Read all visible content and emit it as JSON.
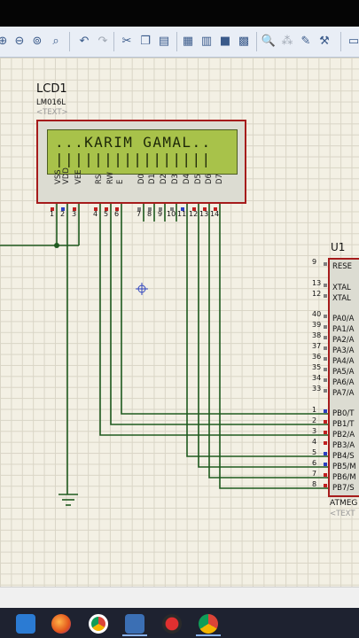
{
  "component_lcd": {
    "ref": "LCD1",
    "model": "LM016L",
    "text_placeholder": "<TEXT>",
    "line1": "...KARIM GAMAL..",
    "line2": "||||||||||||||||",
    "pin_names": [
      "VSS",
      "VDD",
      "VEE",
      "RS",
      "RW",
      "E",
      "D0",
      "D1",
      "D2",
      "D3",
      "D4",
      "D5",
      "D6",
      "D7"
    ],
    "pin_numbers": [
      "1",
      "2",
      "3",
      "4",
      "5",
      "6",
      "7",
      "8",
      "9",
      "10",
      "11",
      "12",
      "13",
      "14"
    ]
  },
  "component_mcu": {
    "ref": "U1",
    "part_label": "ATMEG",
    "text_placeholder": "<TEXT",
    "pins": [
      {
        "num": "9",
        "name": "RESE"
      },
      {
        "num": "13",
        "name": "XTAL"
      },
      {
        "num": "12",
        "name": "XTAL"
      },
      {
        "num": "40",
        "name": "PA0/A"
      },
      {
        "num": "39",
        "name": "PA1/A"
      },
      {
        "num": "38",
        "name": "PA2/A"
      },
      {
        "num": "37",
        "name": "PA3/A"
      },
      {
        "num": "36",
        "name": "PA4/A"
      },
      {
        "num": "35",
        "name": "PA5/A"
      },
      {
        "num": "34",
        "name": "PA6/A"
      },
      {
        "num": "33",
        "name": "PA7/A"
      },
      {
        "num": "1",
        "name": "PB0/T"
      },
      {
        "num": "2",
        "name": "PB1/T"
      },
      {
        "num": "3",
        "name": "PB2/A"
      },
      {
        "num": "4",
        "name": "PB3/A"
      },
      {
        "num": "5",
        "name": "PB4/S"
      },
      {
        "num": "6",
        "name": "PB5/M"
      },
      {
        "num": "7",
        "name": "PB6/M"
      },
      {
        "num": "8",
        "name": "PB7/S"
      }
    ]
  },
  "colors": {
    "wire": "#1f5a1f",
    "border": "#a61c1c",
    "lcd_screen": "#a8c24a",
    "grid": "#d9d5c6",
    "canvas": "#f3f0e4"
  },
  "toolbar_icons": [
    "zoom-in-icon",
    "zoom-out-icon",
    "zoom-all-icon",
    "zoom-area-icon",
    "undo-icon",
    "redo-icon",
    "cut-icon",
    "copy-icon",
    "paste-icon",
    "block-copy-icon",
    "block-move-icon",
    "block-rotate-icon",
    "block-delete-icon",
    "pick-device-icon",
    "make-device-icon",
    "package-tool-icon",
    "decompose-icon"
  ],
  "taskbar_icons": [
    "mail-icon",
    "firefox-icon",
    "chrome-icon",
    "proteus-icon",
    "record-icon",
    "chrome-profile-icon"
  ]
}
